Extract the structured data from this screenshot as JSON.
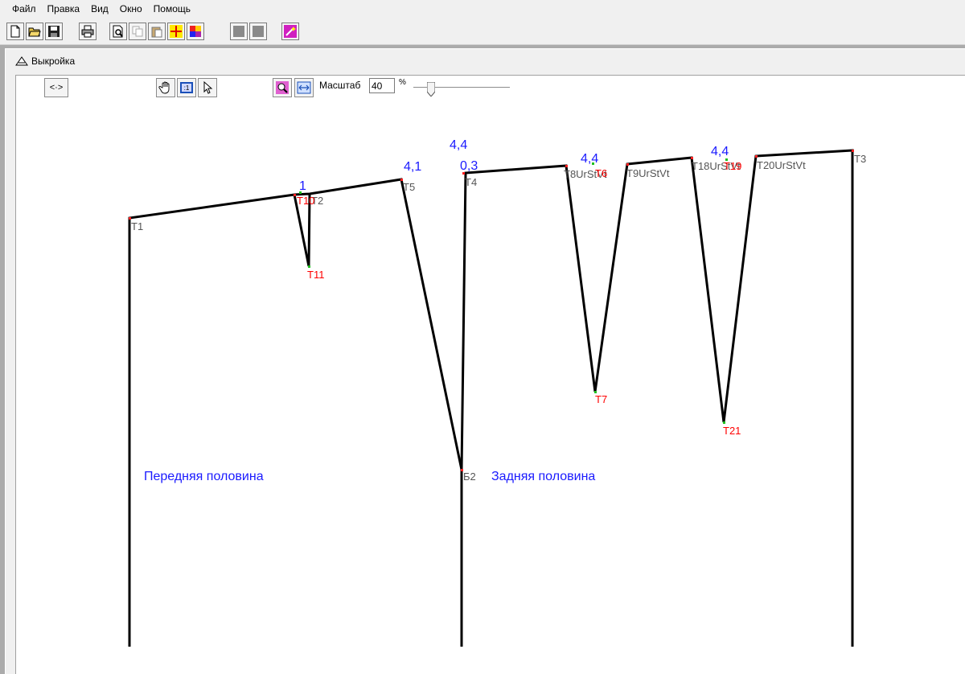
{
  "menu": [
    "Файл",
    "Правка",
    "Вид",
    "Окно",
    "Помощь"
  ],
  "window": {
    "title": "Выкройка"
  },
  "toolbar": {
    "nav_label": "<·>",
    "scale_label": "Масштаб",
    "scale_value": "40",
    "scale_unit": "%",
    "zoom_percent": 40
  },
  "parts": {
    "front": "Передняя половина",
    "back": "Задняя половина"
  },
  "measurements": [
    "1",
    "4,1",
    "4,4",
    "0,3",
    "4,4",
    "4,4"
  ],
  "point_labels_gray": [
    "T1",
    "T2",
    "T5",
    "Т4",
    "Б2",
    "T3",
    "T8UrStVt",
    "T9UrStVt",
    "T18UrStVt",
    "T20UrStVt"
  ],
  "point_labels_red": [
    "T10",
    "T11",
    "T6",
    "T7",
    "T19",
    "T21"
  ],
  "colors": {
    "blue_text": "#1a1aff",
    "red_text": "#ff0000",
    "gray_text": "#555555",
    "line": "#000000"
  }
}
